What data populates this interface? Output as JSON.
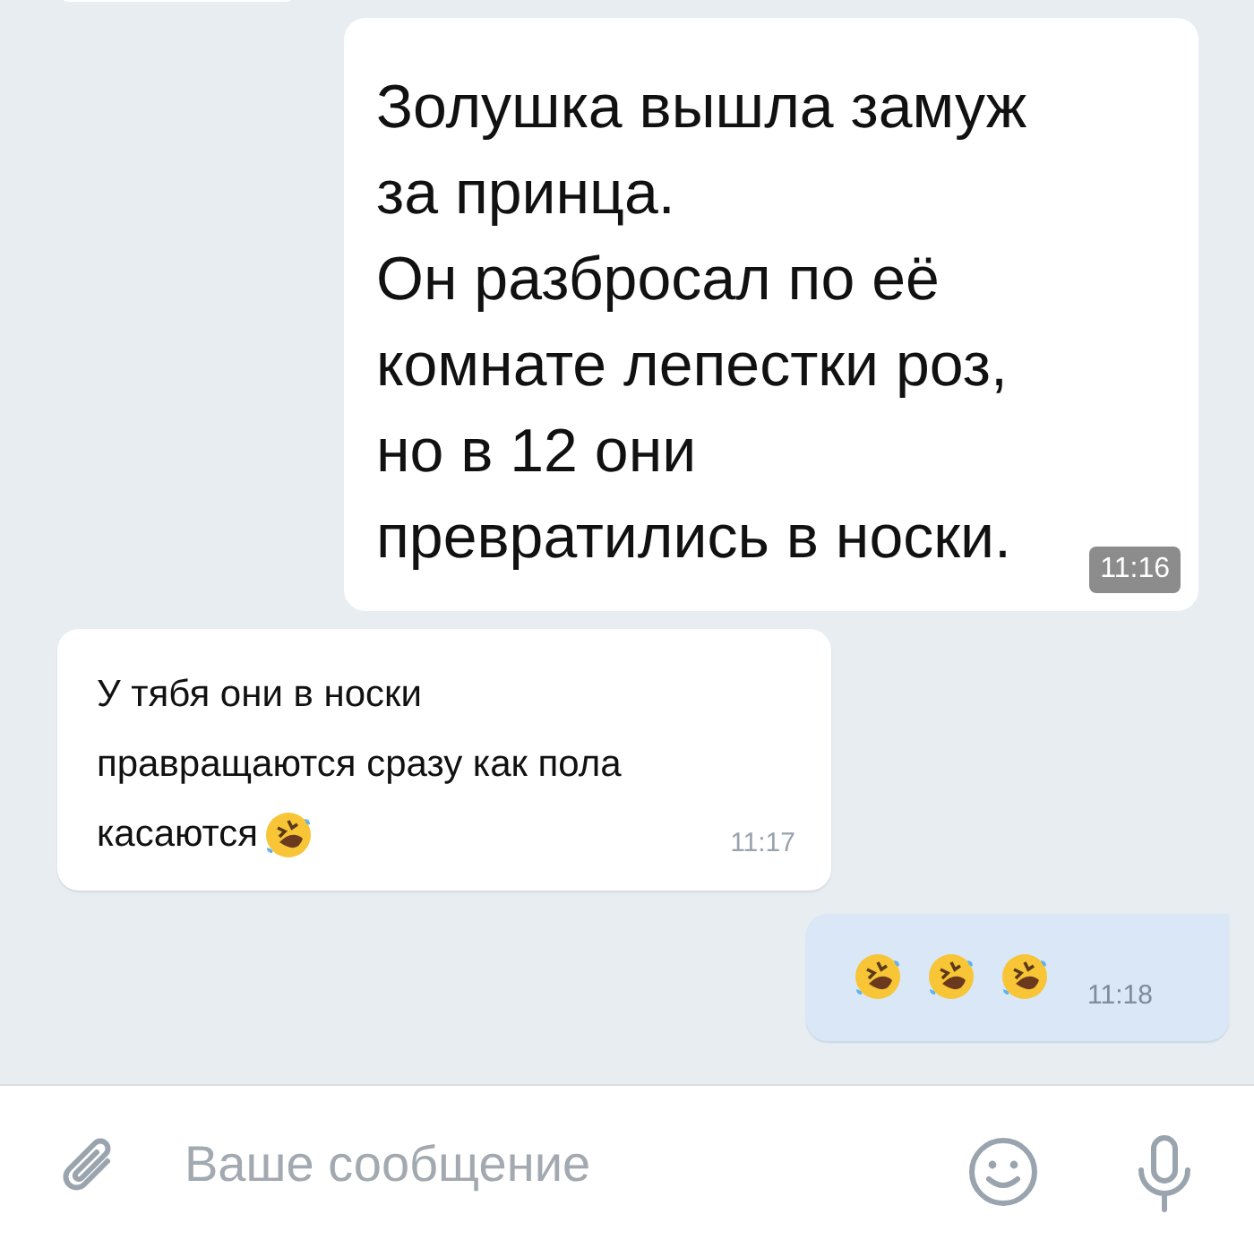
{
  "messages": [
    {
      "kind": "outgoing",
      "large": true,
      "lines": [
        "Золушка вышла замуж",
        "за принца.",
        "Он разбросал по её",
        "комнате лепестки роз,",
        "но в 12 они",
        "превратились в носки."
      ],
      "time": "11:16",
      "time_badge": true
    },
    {
      "kind": "incoming",
      "large": false,
      "lines": [
        "У тябя они в носки",
        "правращаются сразу как пола",
        "касаются"
      ],
      "emojis": [
        {
          "kind": "rofl"
        }
      ],
      "time": "11:17",
      "time_badge": false
    },
    {
      "kind": "outgoing_tail",
      "emojis": [
        {
          "kind": "rofl"
        },
        {
          "kind": "rofl"
        },
        {
          "kind": "rofl"
        }
      ],
      "time": "11:18",
      "time_badge": false
    }
  ],
  "composer": {
    "placeholder": "Ваше сообщение"
  }
}
